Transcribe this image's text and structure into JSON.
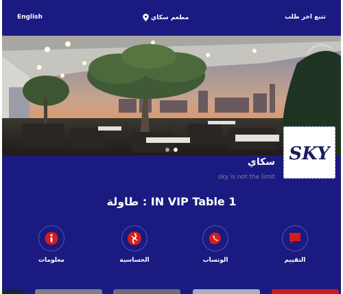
{
  "topbar": {
    "language_label": "English",
    "restaurant_label": "مطعم سكاي",
    "track_order_label": "تتبع اخر طلب"
  },
  "hero": {
    "image_alt": "Rooftop restaurant terrace with a large tree at sunset"
  },
  "store": {
    "logo_text": "SKY",
    "name": "سكاي",
    "tagline": "sky is not the limit"
  },
  "table": {
    "title": "طاولة : IN VIP Table 1"
  },
  "actions": [
    {
      "label": "معلومات",
      "icon": "info-icon"
    },
    {
      "label": "الحساسية",
      "icon": "allergy-icon"
    },
    {
      "label": "الوتساب",
      "icon": "whatsapp-icon"
    },
    {
      "label": "التقييم",
      "icon": "review-icon"
    }
  ],
  "colors": {
    "background": "#1a1a80",
    "accent_red": "#d41d1d",
    "logo_navy": "#1c1c5e",
    "muted_text": "#8080a8"
  }
}
